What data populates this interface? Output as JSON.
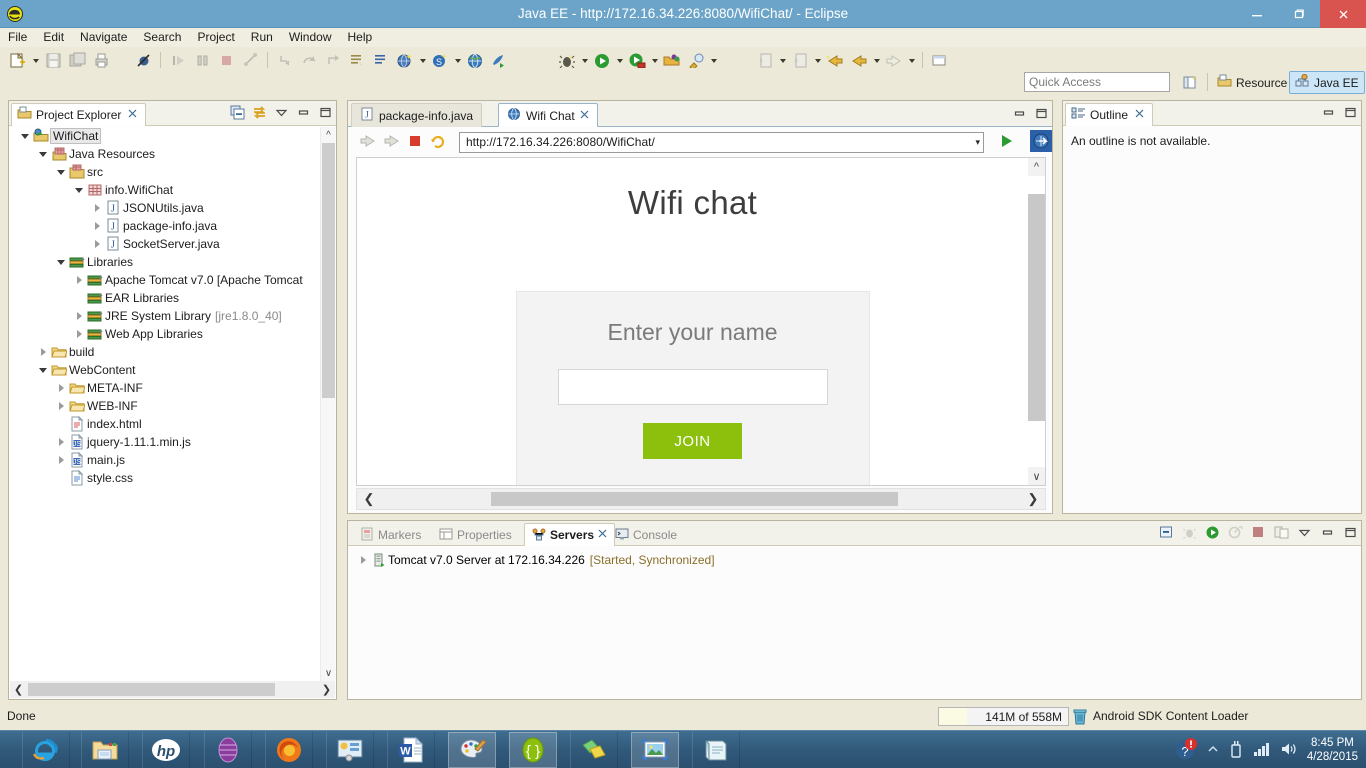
{
  "window": {
    "title": "Java EE - http://172.16.34.226:8080/WifiChat/ - Eclipse",
    "app_icon": "eclipse-icon",
    "minimize_label": "–",
    "maximize_label": "❐",
    "close_label": "✕"
  },
  "menubar": {
    "items": [
      {
        "label": "File"
      },
      {
        "label": "Edit"
      },
      {
        "label": "Navigate"
      },
      {
        "label": "Search"
      },
      {
        "label": "Project"
      },
      {
        "label": "Run"
      },
      {
        "label": "Window"
      },
      {
        "label": "Help"
      }
    ]
  },
  "quick_access": {
    "placeholder": "Quick Access",
    "value": "",
    "new_perspective_icon": "new-perspective-icon",
    "perspectives": [
      {
        "label": "Resource",
        "icon": "resource-perspective-icon",
        "active": false
      },
      {
        "label": "Java EE",
        "icon": "javaee-perspective-icon",
        "active": true
      }
    ]
  },
  "project_explorer": {
    "tab_label": "Project Explorer",
    "tab_icon": "project-explorer-icon",
    "close_label": "✕",
    "tool_icons": [
      "collapse-all-icon",
      "link-with-editor-icon",
      "view-menu-icon",
      "minimize-icon",
      "maximize-icon"
    ],
    "tree": [
      {
        "indent": 0,
        "twisty": "expanded",
        "icon": "project-icon",
        "label": "WifiChat",
        "selected": true,
        "dim": ""
      },
      {
        "indent": 1,
        "twisty": "expanded",
        "icon": "java-resources-icon",
        "label": "Java Resources",
        "selected": false,
        "dim": ""
      },
      {
        "indent": 2,
        "twisty": "expanded",
        "icon": "source-folder-icon",
        "label": "src",
        "selected": false,
        "dim": ""
      },
      {
        "indent": 3,
        "twisty": "expanded",
        "icon": "package-icon",
        "label": "info.WifiChat",
        "selected": false,
        "dim": ""
      },
      {
        "indent": 4,
        "twisty": "collapsed",
        "icon": "java-file-icon",
        "label": "JSONUtils.java",
        "selected": false,
        "dim": ""
      },
      {
        "indent": 4,
        "twisty": "collapsed",
        "icon": "java-file-icon",
        "label": "package-info.java",
        "selected": false,
        "dim": ""
      },
      {
        "indent": 4,
        "twisty": "collapsed",
        "icon": "java-file-icon",
        "label": "SocketServer.java",
        "selected": false,
        "dim": ""
      },
      {
        "indent": 2,
        "twisty": "expanded",
        "icon": "library-icon",
        "label": "Libraries",
        "selected": false,
        "dim": ""
      },
      {
        "indent": 3,
        "twisty": "collapsed",
        "icon": "library-icon",
        "label": "Apache Tomcat v7.0 [Apache Tomcat",
        "selected": false,
        "dim": ""
      },
      {
        "indent": 3,
        "twisty": "none",
        "icon": "library-icon",
        "label": "EAR Libraries",
        "selected": false,
        "dim": ""
      },
      {
        "indent": 3,
        "twisty": "collapsed",
        "icon": "library-icon",
        "label": "JRE System Library",
        "selected": false,
        "dim": "[jre1.8.0_40]"
      },
      {
        "indent": 3,
        "twisty": "collapsed",
        "icon": "library-icon",
        "label": "Web App Libraries",
        "selected": false,
        "dim": ""
      },
      {
        "indent": 1,
        "twisty": "collapsed",
        "icon": "folder-icon",
        "label": "build",
        "selected": false,
        "dim": ""
      },
      {
        "indent": 1,
        "twisty": "expanded",
        "icon": "folder-icon",
        "label": "WebContent",
        "selected": false,
        "dim": ""
      },
      {
        "indent": 2,
        "twisty": "collapsed",
        "icon": "folder-icon",
        "label": "META-INF",
        "selected": false,
        "dim": ""
      },
      {
        "indent": 2,
        "twisty": "collapsed",
        "icon": "folder-icon",
        "label": "WEB-INF",
        "selected": false,
        "dim": ""
      },
      {
        "indent": 2,
        "twisty": "none",
        "icon": "html-file-icon",
        "label": "index.html",
        "selected": false,
        "dim": ""
      },
      {
        "indent": 2,
        "twisty": "collapsed",
        "icon": "js-file-icon",
        "label": "jquery-1.11.1.min.js",
        "selected": false,
        "dim": ""
      },
      {
        "indent": 2,
        "twisty": "collapsed",
        "icon": "js-file-icon",
        "label": "main.js",
        "selected": false,
        "dim": ""
      },
      {
        "indent": 2,
        "twisty": "none",
        "icon": "css-file-icon",
        "label": "style.css",
        "selected": false,
        "dim": ""
      }
    ]
  },
  "editor": {
    "tabs": [
      {
        "label": "package-info.java",
        "icon": "java-file-icon",
        "active": false,
        "closeable": false
      },
      {
        "label": "Wifi Chat",
        "icon": "web-browser-icon",
        "active": true,
        "closeable": true
      }
    ],
    "close_label": "✕",
    "tool_icons": [
      "minimize-icon",
      "maximize-icon"
    ],
    "browser": {
      "back_icon": "back-arrow-icon",
      "forward_icon": "forward-arrow-icon",
      "stop_icon": "stop-icon",
      "refresh_icon": "refresh-icon",
      "url": "http://172.16.34.226:8080/WifiChat/",
      "url_placeholder": "",
      "dropdown_caret": "⌄",
      "go_icon": "go-icon",
      "open-external_icon": "open-external-browser-icon"
    },
    "page": {
      "title": "Wifi chat",
      "card_heading": "Enter your name",
      "input_value": "",
      "input_placeholder": "",
      "join_button": "JOIN",
      "join_color": "#8cc00c"
    }
  },
  "outline": {
    "tab_label": "Outline",
    "tab_icon": "outline-icon",
    "close_label": "✕",
    "message": "An outline is not available.",
    "tool_icons": [
      "minimize-icon",
      "maximize-icon"
    ]
  },
  "bottom_panel": {
    "tabs": [
      {
        "label": "Markers",
        "icon": "markers-icon",
        "active": false,
        "closeable": false
      },
      {
        "label": "Properties",
        "icon": "properties-icon",
        "active": false,
        "closeable": false
      },
      {
        "label": "Servers",
        "icon": "servers-icon",
        "active": true,
        "closeable": true
      },
      {
        "label": "Console",
        "icon": "console-icon",
        "active": false,
        "closeable": false
      }
    ],
    "close_label": "✕",
    "tool_icons": [
      "new-server-icon",
      "debug-icon",
      "start-icon",
      "profile-icon",
      "stop-icon",
      "publish-icon",
      "view-menu-icon",
      "minimize-icon",
      "maximize-icon"
    ],
    "servers": [
      {
        "twisty": "collapsed",
        "icon": "server-icon",
        "name": "Tomcat v7.0 Server at 172.16.34.226",
        "status": "[Started, Synchronized]"
      }
    ]
  },
  "statusbar": {
    "status_text": "Done",
    "heap": "141M of 558M",
    "heap_trash_icon": "trash-icon",
    "task_text": "Android SDK Content Loader"
  },
  "taskbar": {
    "items": [
      {
        "name": "internet-explorer-icon",
        "active": false
      },
      {
        "name": "file-explorer-icon",
        "active": false
      },
      {
        "name": "hp-icon",
        "active": false
      },
      {
        "name": "oracle-vm-icon",
        "active": false
      },
      {
        "name": "firefox-icon",
        "active": false
      },
      {
        "name": "remote-desktop-icon",
        "active": false
      },
      {
        "name": "microsoft-word-icon",
        "active": false
      },
      {
        "name": "paint-icon",
        "active": true
      },
      {
        "name": "json-viewer-icon",
        "active": true
      },
      {
        "name": "sticky-notes-icon",
        "active": false
      },
      {
        "name": "photo-viewer-icon",
        "active": true
      },
      {
        "name": "notepad-icon",
        "active": false
      }
    ],
    "tray": {
      "action_center_icon": "action-center-alert-icon",
      "show_hidden_icon": "show-hidden-icons-icon",
      "usb_icon": "usb-device-icon",
      "network_icon": "network-signal-icon",
      "volume_icon": "volume-icon",
      "time": "8:45 PM",
      "date": "4/28/2015"
    }
  }
}
